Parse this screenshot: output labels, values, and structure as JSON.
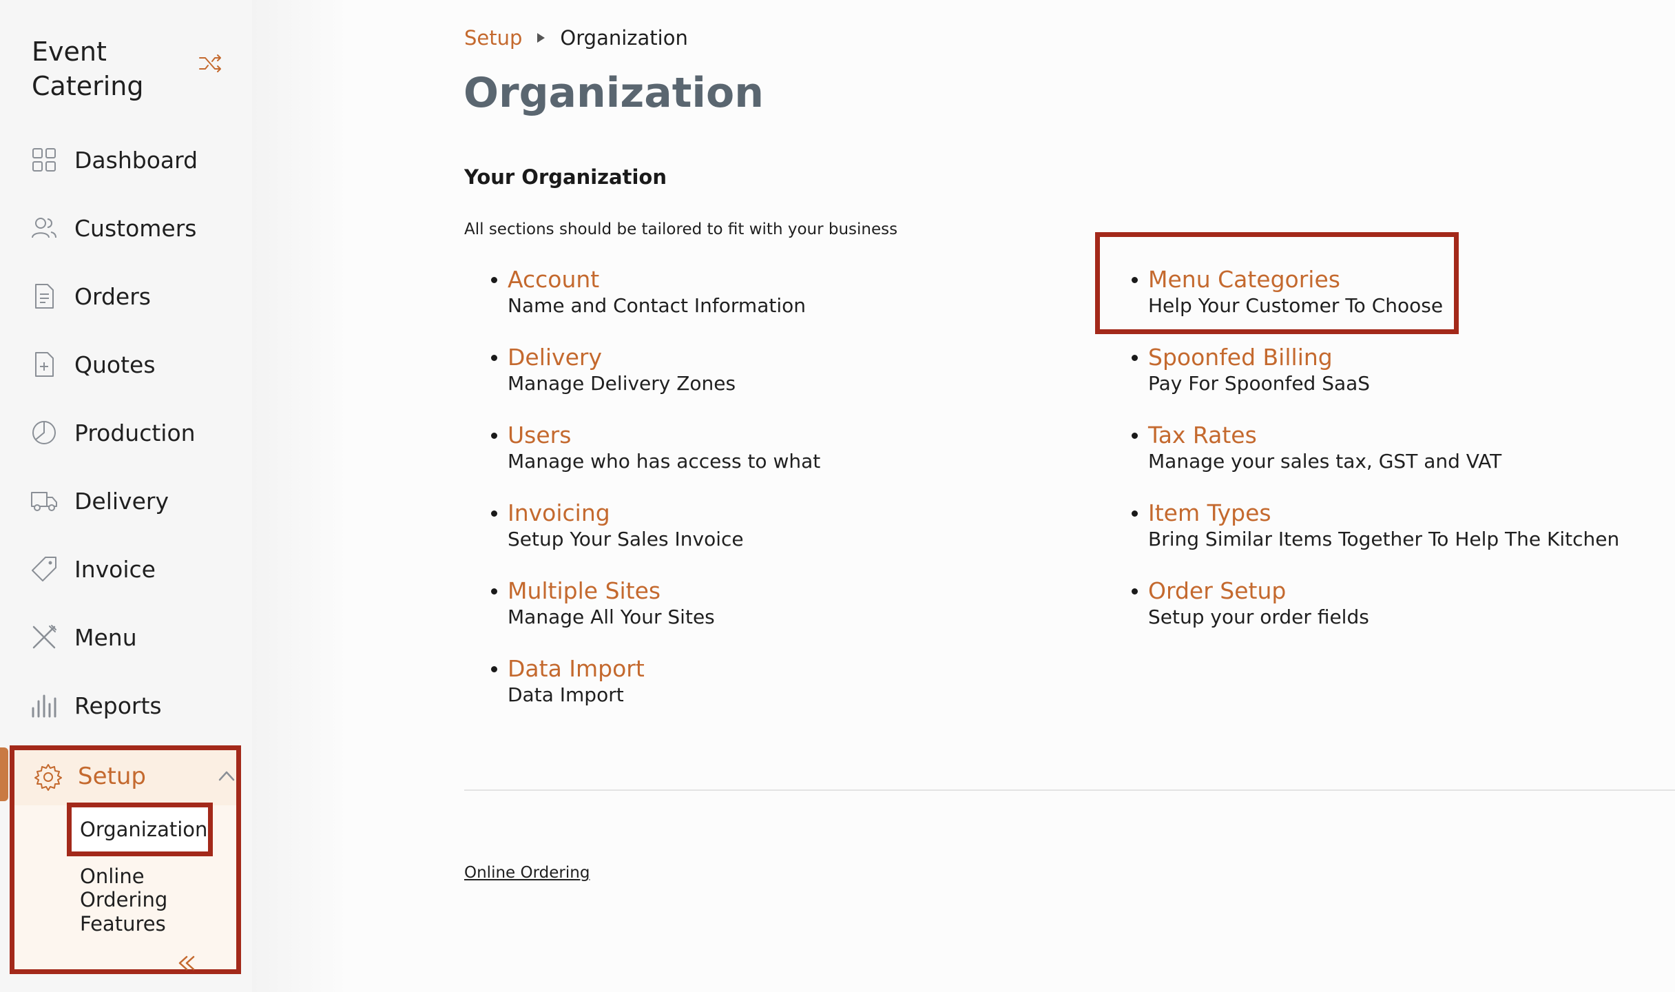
{
  "app": {
    "brand": "Event Catering"
  },
  "sidebar": {
    "items": [
      {
        "label": "Dashboard",
        "icon": "grid-icon"
      },
      {
        "label": "Customers",
        "icon": "users-icon"
      },
      {
        "label": "Orders",
        "icon": "document-icon"
      },
      {
        "label": "Quotes",
        "icon": "file-plus-icon"
      },
      {
        "label": "Production",
        "icon": "pie-chart-icon"
      },
      {
        "label": "Delivery",
        "icon": "truck-icon"
      },
      {
        "label": "Invoice",
        "icon": "tag-icon"
      },
      {
        "label": "Menu",
        "icon": "utensils-icon"
      },
      {
        "label": "Reports",
        "icon": "bar-chart-icon"
      }
    ],
    "setup": {
      "label": "Setup",
      "icon": "gear-icon",
      "children": [
        "Organization",
        "Online Ordering",
        "Features"
      ]
    }
  },
  "breadcrumb": {
    "parent": "Setup",
    "current": "Organization"
  },
  "page": {
    "title": "Organization",
    "section_title": "Your Organization",
    "section_desc": "All sections should be tailored to fit with your business",
    "left_entries": [
      {
        "title": "Account",
        "sub": "Name and Contact Information"
      },
      {
        "title": "Delivery",
        "sub": "Manage Delivery Zones"
      },
      {
        "title": "Users",
        "sub": "Manage who has access to what"
      },
      {
        "title": "Invoicing",
        "sub": "Setup Your Sales Invoice"
      },
      {
        "title": "Multiple Sites",
        "sub": "Manage All Your Sites"
      },
      {
        "title": "Data Import",
        "sub": "Data Import"
      }
    ],
    "right_entries": [
      {
        "title": "Menu Categories",
        "sub": "Help Your Customer To Choose"
      },
      {
        "title": "Spoonfed Billing",
        "sub": "Pay For Spoonfed SaaS"
      },
      {
        "title": "Tax Rates",
        "sub": "Manage your sales tax, GST and VAT"
      },
      {
        "title": "Item Types",
        "sub": "Bring Similar Items Together To Help The Kitchen"
      },
      {
        "title": "Order Setup",
        "sub": "Setup your order fields"
      }
    ],
    "footer_link": "Online Ordering"
  },
  "colors": {
    "accent": "#c4692e",
    "highlight": "#a3291a",
    "title": "#5a6670"
  }
}
